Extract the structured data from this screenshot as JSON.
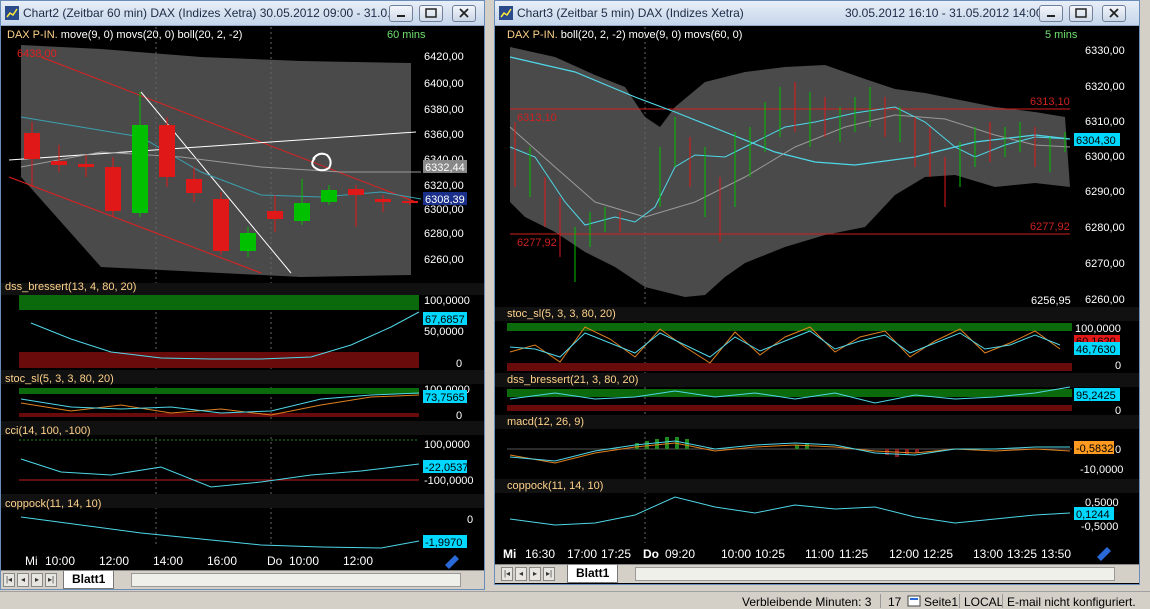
{
  "window1": {
    "title": "Chart2 (Zeitbar 60 min)  DAX (Indizes Xetra) 30.05.2012 09:00 - 31.0...",
    "instrument_label": "DAX P-IN.",
    "overlay_label": "move(9, 0) movs(20, 0) boll(20, 2, -2)",
    "timeframe": "60 mins",
    "price_ticks": [
      "6420,00",
      "6400,00",
      "6380,00",
      "6360,00",
      "6340,00",
      "6320,00",
      "6300,00",
      "6280,00",
      "6260,00"
    ],
    "price_marker_top": "6438,00",
    "price_flag_1": "6332,44",
    "price_flag_2": "6308,39",
    "panels": [
      {
        "label": "dss_bressert(13, 4, 80, 20)",
        "ticks": [
          "100,0000",
          "50,0000",
          "0"
        ],
        "value": "67,6857"
      },
      {
        "label": "stoc_sl(5, 3, 3, 80, 20)",
        "ticks": [
          "100,0000",
          "0"
        ],
        "value": "73,7565"
      },
      {
        "label": "cci(14, 100, -100)",
        "ticks": [
          "100,0000",
          "-100,0000"
        ],
        "value": "-22,0537"
      },
      {
        "label": "coppock(11, 14, 10)",
        "ticks": [
          "0"
        ],
        "value": "-1,9970"
      }
    ],
    "time_labels": [
      "Mi",
      "10:00",
      "12:00",
      "14:00",
      "16:00",
      "Do",
      "10:00",
      "12:00"
    ],
    "sheet_tab": "Blatt1"
  },
  "window2": {
    "title": "Chart3 (Zeitbar 5 min)  DAX (Indizes Xetra)",
    "date_range": "30.05.2012 16:10 - 31.05.2012 14:00",
    "instrument_label": "DAX P-IN.",
    "overlay_label": "boll(20, 2, -2) move(9, 0) movs(60, 0)",
    "timeframe": "5 mins",
    "price_ticks": [
      "6330,00",
      "6320,00",
      "6310,00",
      "6300,00",
      "6290,00",
      "6280,00",
      "6270,00",
      "6260,00"
    ],
    "level_high": "6313,10",
    "level_low": "6277,92",
    "level_high_right": "6313,10",
    "level_low_right": "6277,92",
    "low_label": "6256,95",
    "price_flag": "6304,30",
    "panels": [
      {
        "label": "stoc_sl(5, 3, 3, 80, 20)",
        "ticks": [
          "100,0000",
          "0"
        ],
        "value": "46,7630",
        "value2": "60,1620"
      },
      {
        "label": "dss_bressert(21, 3, 80, 20)",
        "ticks": [
          "0"
        ],
        "value": "95,2425"
      },
      {
        "label": "macd(12, 26, 9)",
        "ticks": [
          "0",
          "-10,0000"
        ],
        "value": "-0,5832"
      },
      {
        "label": "coppock(11, 14, 10)",
        "ticks": [
          "0,5000",
          "-0,5000"
        ],
        "value": "0,1244"
      }
    ],
    "time_labels": [
      "Mi",
      "16:30",
      "17:00",
      "17:25",
      "Do",
      "09:20",
      "10:00",
      "10:25",
      "11:00",
      "11:25",
      "12:00",
      "12:25",
      "13:00",
      "13:25",
      "13:50"
    ],
    "sheet_tab": "Blatt1"
  },
  "statusbar": {
    "remaining": "Verbleibende Minuten: 3",
    "count": "17",
    "page": "Seite1",
    "mode": "LOCAL",
    "email": "E-mail nicht konfiguriert."
  },
  "colors": {
    "up_candle": "#00c000",
    "down_candle": "#e01818",
    "band_fill": "#4a4a4a",
    "label_orange": "#ffd28a",
    "value_box": "#00e5ff",
    "level_red": "#d02020"
  }
}
